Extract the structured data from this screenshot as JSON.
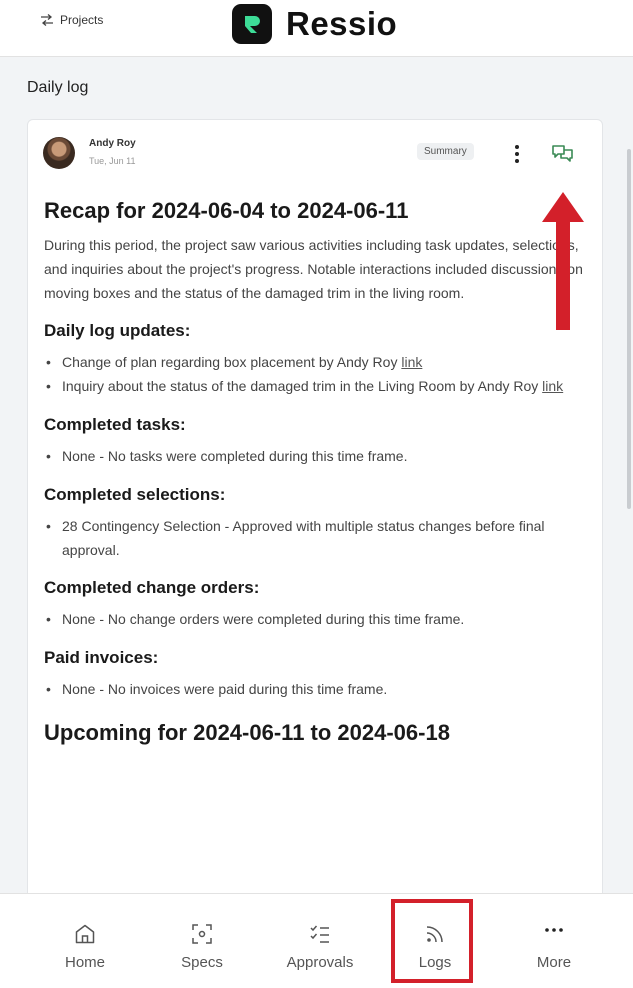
{
  "header": {
    "projects_label": "Projects",
    "brand_name": "Ressio"
  },
  "page": {
    "section_title": "Daily log"
  },
  "log": {
    "author": "Andy Roy",
    "date": "Tue, Jun 11",
    "badge": "Summary",
    "recap_title": "Recap for 2024-06-04 to 2024-06-11",
    "intro": "During this period, the project saw various activities including task updates, selections, and inquiries about the project's progress. Notable interactions included discussions on moving boxes and the status of the damaged trim in the living room.",
    "sections": {
      "daily": {
        "heading": "Daily log updates:",
        "item1": "Change of plan regarding box placement by Andy Roy",
        "item2": "Inquiry about the status of the damaged trim in the Living Room by Andy Roy",
        "link_text": "link"
      },
      "tasks": {
        "heading": "Completed tasks:",
        "item1": "None - No tasks were completed during this time frame."
      },
      "selections": {
        "heading": "Completed selections:",
        "item1": "28 Contingency Selection - Approved with multiple status changes before final approval."
      },
      "change_orders": {
        "heading": "Completed change orders:",
        "item1": "None - No change orders were completed during this time frame."
      },
      "invoices": {
        "heading": "Paid invoices:",
        "item1": "None - No invoices were paid during this time frame."
      }
    },
    "upcoming_title": "Upcoming for 2024-06-11 to 2024-06-18"
  },
  "nav": {
    "home": "Home",
    "specs": "Specs",
    "approvals": "Approvals",
    "logs": "Logs",
    "more": "More"
  },
  "colors": {
    "annotation_red": "#d3202a",
    "brand_dark": "#111111",
    "brand_green": "#3ddc97",
    "icon_green": "#3a8a55"
  }
}
